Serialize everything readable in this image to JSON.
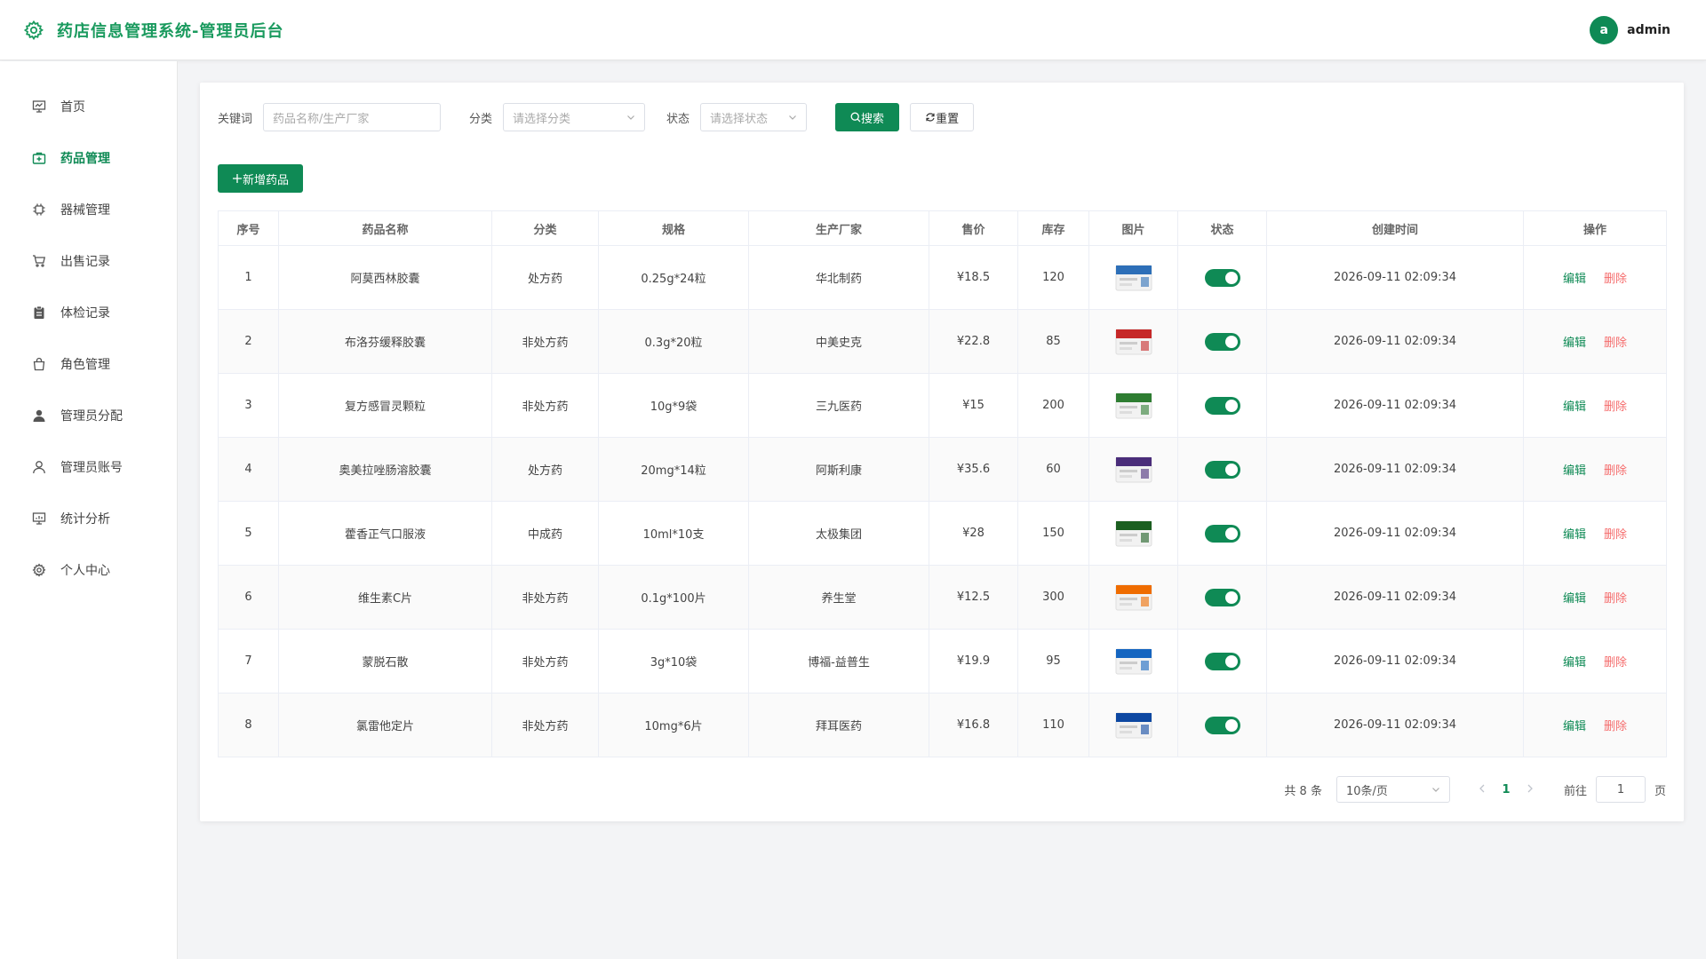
{
  "header": {
    "title": "药店信息管理系统-管理员后台",
    "avatar_letter": "a",
    "username": "admin"
  },
  "colors": {
    "primary": "#0f8a55",
    "danger": "#f56c6c",
    "title": "#1a9a5e"
  },
  "sidebar": {
    "items": [
      {
        "label": "首页",
        "icon": "dashboard-icon"
      },
      {
        "label": "药品管理",
        "icon": "medicine-box-icon",
        "active": true
      },
      {
        "label": "器械管理",
        "icon": "device-icon"
      },
      {
        "label": "出售记录",
        "icon": "cart-icon"
      },
      {
        "label": "体检记录",
        "icon": "clipboard-icon"
      },
      {
        "label": "角色管理",
        "icon": "bag-icon"
      },
      {
        "label": "管理员分配",
        "icon": "user-filled-icon"
      },
      {
        "label": "管理员账号",
        "icon": "user-icon"
      },
      {
        "label": "统计分析",
        "icon": "chart-icon"
      },
      {
        "label": "个人中心",
        "icon": "settings-icon"
      }
    ]
  },
  "filters": {
    "keyword_label": "关键词",
    "keyword_placeholder": "药品名称/生产厂家",
    "category_label": "分类",
    "category_placeholder": "请选择分类",
    "status_label": "状态",
    "status_placeholder": "请选择状态",
    "search_label": "搜索",
    "reset_label": "重置"
  },
  "actions": {
    "add_label": "新增药品"
  },
  "table": {
    "columns": [
      "序号",
      "药品名称",
      "分类",
      "规格",
      "生产厂家",
      "售价",
      "库存",
      "图片",
      "状态",
      "创建时间",
      "操作"
    ],
    "edit_label": "编辑",
    "delete_label": "删除",
    "rows": [
      {
        "no": "1",
        "name": "阿莫西林胶囊",
        "category": "处方药",
        "spec": "0.25g*24粒",
        "maker": "华北制药",
        "price": "¥18.5",
        "stock": "120",
        "status": true,
        "created": "2026-09-11 02:09:34"
      },
      {
        "no": "2",
        "name": "布洛芬缓释胶囊",
        "category": "非处方药",
        "spec": "0.3g*20粒",
        "maker": "中美史克",
        "price": "¥22.8",
        "stock": "85",
        "status": true,
        "created": "2026-09-11 02:09:34"
      },
      {
        "no": "3",
        "name": "复方感冒灵颗粒",
        "category": "非处方药",
        "spec": "10g*9袋",
        "maker": "三九医药",
        "price": "¥15",
        "stock": "200",
        "status": true,
        "created": "2026-09-11 02:09:34"
      },
      {
        "no": "4",
        "name": "奥美拉唑肠溶胶囊",
        "category": "处方药",
        "spec": "20mg*14粒",
        "maker": "阿斯利康",
        "price": "¥35.6",
        "stock": "60",
        "status": true,
        "created": "2026-09-11 02:09:34"
      },
      {
        "no": "5",
        "name": "藿香正气口服液",
        "category": "中成药",
        "spec": "10ml*10支",
        "maker": "太极集团",
        "price": "¥28",
        "stock": "150",
        "status": true,
        "created": "2026-09-11 02:09:34"
      },
      {
        "no": "6",
        "name": "维生素C片",
        "category": "非处方药",
        "spec": "0.1g*100片",
        "maker": "养生堂",
        "price": "¥12.5",
        "stock": "300",
        "status": true,
        "created": "2026-09-11 02:09:34"
      },
      {
        "no": "7",
        "name": "蒙脱石散",
        "category": "非处方药",
        "spec": "3g*10袋",
        "maker": "博福-益普生",
        "price": "¥19.9",
        "stock": "95",
        "status": true,
        "created": "2026-09-11 02:09:34"
      },
      {
        "no": "8",
        "name": "氯雷他定片",
        "category": "非处方药",
        "spec": "10mg*6片",
        "maker": "拜耳医药",
        "price": "¥16.8",
        "stock": "110",
        "status": true,
        "created": "2026-09-11 02:09:34"
      }
    ]
  },
  "pagination": {
    "total_text": "共 8 条",
    "page_size": "10条/页",
    "current_page": "1",
    "goto_label": "前往",
    "goto_value": "1",
    "page_suffix": "页"
  }
}
